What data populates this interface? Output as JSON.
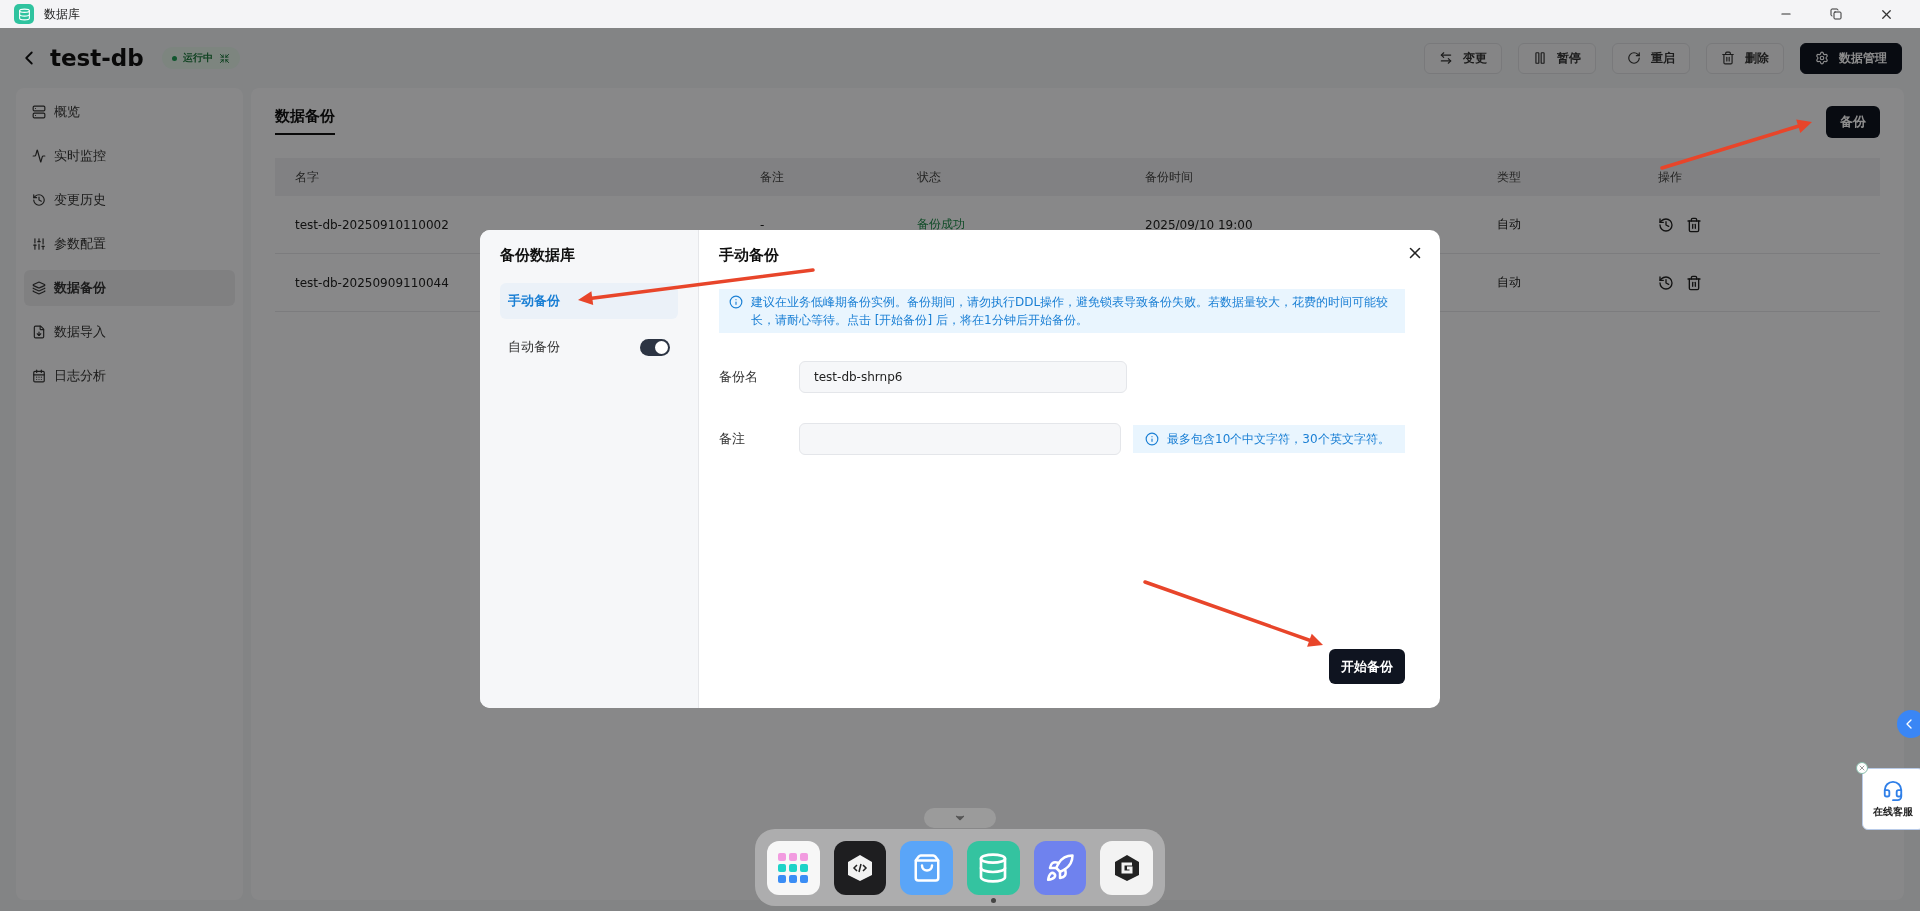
{
  "window": {
    "title": "数据库"
  },
  "header": {
    "title": "test-db",
    "status": "运行中",
    "actions": [
      {
        "label": "变更",
        "kind": "swap"
      },
      {
        "label": "暂停",
        "kind": "pause"
      },
      {
        "label": "重启",
        "kind": "restart"
      },
      {
        "label": "删除",
        "kind": "delete"
      },
      {
        "label": "数据管理",
        "kind": "primary"
      }
    ]
  },
  "sidebar": {
    "items": [
      {
        "label": "概览",
        "kind": "overview",
        "selected": false
      },
      {
        "label": "实时监控",
        "kind": "monitor",
        "selected": false
      },
      {
        "label": "变更历史",
        "kind": "history",
        "selected": false
      },
      {
        "label": "参数配置",
        "kind": "params",
        "selected": false
      },
      {
        "label": "数据备份",
        "kind": "backup",
        "selected": true
      },
      {
        "label": "数据导入",
        "kind": "import",
        "selected": false
      },
      {
        "label": "日志分析",
        "kind": "logs",
        "selected": false
      }
    ]
  },
  "content": {
    "tabs": [
      {
        "label": "数据备份",
        "selected": true
      }
    ],
    "backup_button": "备份",
    "table": {
      "columns": [
        "名字",
        "备注",
        "状态",
        "备份时间",
        "类型",
        "操作"
      ],
      "rows": [
        {
          "name": "test-db-20250910110002",
          "remark": "-",
          "status": "备份成功",
          "time": "2025/09/10 19:00",
          "type": "自动"
        },
        {
          "name": "test-db-20250909110044",
          "type": "自动"
        }
      ]
    }
  },
  "modal": {
    "title": "备份数据库",
    "menu": [
      {
        "label": "手动备份",
        "kind": "link",
        "selected": true
      },
      {
        "label": "自动备份",
        "kind": "toggle",
        "selected": false,
        "on": true
      }
    ],
    "heading": "手动备份",
    "notice": "建议在业务低峰期备份实例。备份期间，请勿执行DDL操作，避免锁表导致备份失败。若数据量较大，花费的时间可能较长，请耐心等待。点击 [开始备份] 后，将在1分钟后开始备份。",
    "fields": [
      {
        "label": "备份名",
        "value": "test-db-shrnp6"
      },
      {
        "label": "备注",
        "hint": "最多包含10个中文字符，30个英文字符。"
      }
    ],
    "submit": "开始备份"
  },
  "support_widget": {
    "label": "在线客服"
  }
}
